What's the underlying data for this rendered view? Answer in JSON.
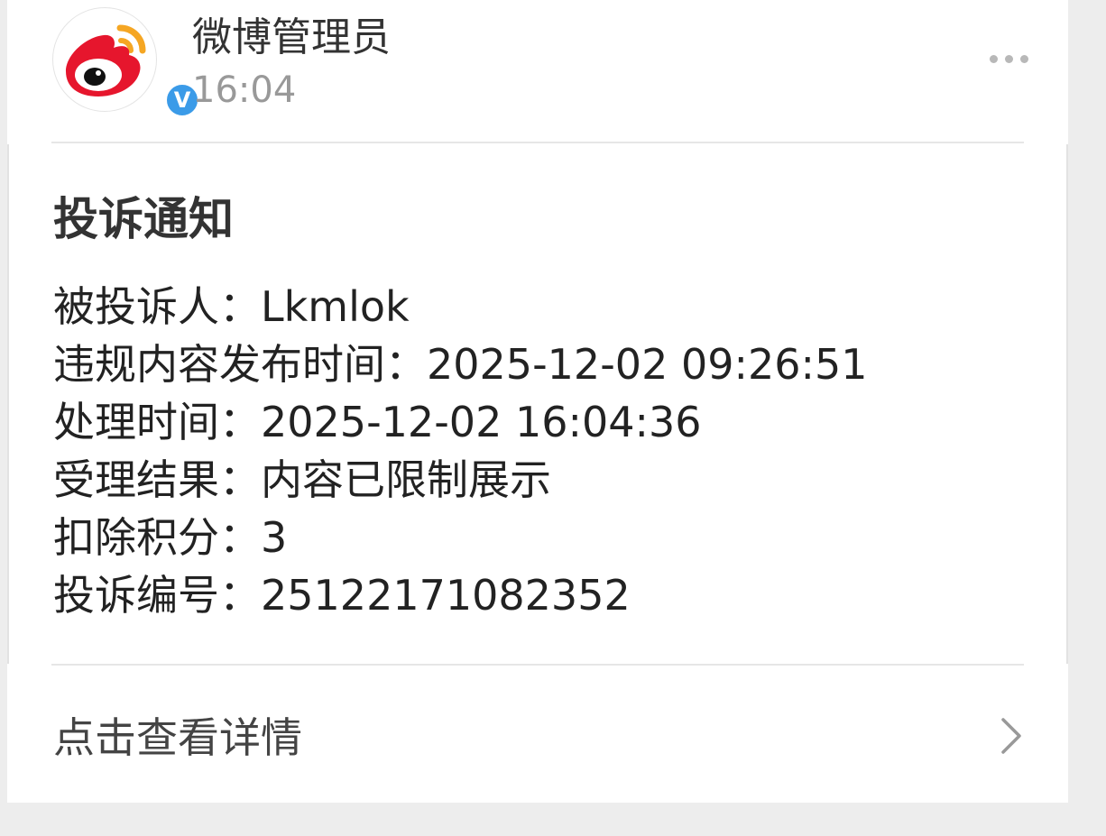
{
  "header": {
    "sender_name": "微博管理员",
    "time": "16:04",
    "verified_mark": "V",
    "avatar_icon": "weibo-logo-icon",
    "more_icon": "more-dots-icon"
  },
  "notice": {
    "title": "投诉通知",
    "fields": [
      {
        "label": "被投诉人：",
        "value": "Lkmlok"
      },
      {
        "label": "违规内容发布时间：",
        "value": "2025-12-02 09:26:51"
      },
      {
        "label": "处理时间：",
        "value": "2025-12-02 16:04:36"
      },
      {
        "label": "受理结果：",
        "value": "内容已限制展示"
      },
      {
        "label": "扣除积分：",
        "value": "3"
      },
      {
        "label": "投诉编号：",
        "value": "25122171082352"
      }
    ]
  },
  "footer": {
    "detail_label": "点击查看详情",
    "chevron_icon": "chevron-right-icon"
  },
  "colors": {
    "background": "#ededed",
    "card": "#ffffff",
    "name_text": "#333333",
    "time_text": "#999999",
    "verified_badge": "#3b9be8",
    "weibo_red": "#e6162d",
    "weibo_orange": "#f5a623"
  }
}
